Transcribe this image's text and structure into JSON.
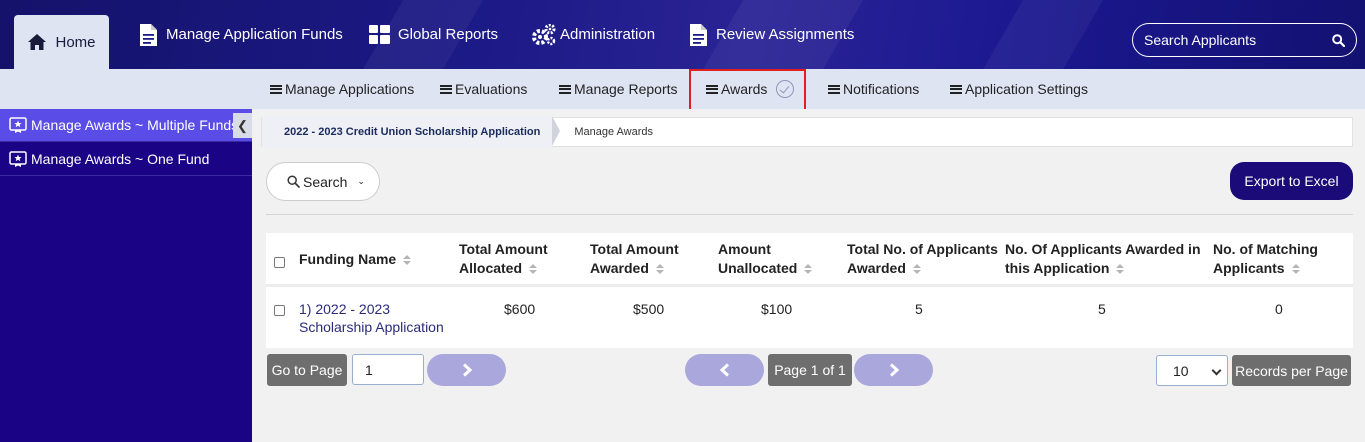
{
  "topnav": {
    "items": [
      {
        "label": "Home",
        "icon": "home-icon"
      },
      {
        "label": "Manage Application Funds",
        "icon": "document-icon"
      },
      {
        "label": "Global Reports",
        "icon": "grid-icon"
      },
      {
        "label": "Administration",
        "icon": "gears-icon"
      },
      {
        "label": "Review Assignments",
        "icon": "document-icon"
      }
    ],
    "search_placeholder": "Search Applicants"
  },
  "subnav": {
    "items": [
      {
        "label": "Manage Applications"
      },
      {
        "label": "Evaluations"
      },
      {
        "label": "Manage Reports"
      },
      {
        "label": "Awards"
      },
      {
        "label": "Notifications"
      },
      {
        "label": "Application Settings"
      }
    ],
    "active": "Awards"
  },
  "sidebar": {
    "items": [
      {
        "label": "Manage Awards ~ Multiple Funds",
        "active": true
      },
      {
        "label": "Manage Awards ~ One Fund",
        "active": false
      }
    ]
  },
  "breadcrumb": {
    "parent": "2022 - 2023 Credit Union Scholarship Application",
    "current": "Manage Awards"
  },
  "toolbar": {
    "search_label": "Search",
    "export_label": "Export to Excel"
  },
  "table": {
    "headers": {
      "funding_name": "Funding Name",
      "total_allocated_1": "Total Amount",
      "total_allocated_2": "Allocated",
      "total_awarded_1": "Total Amount",
      "total_awarded_2": "Awarded",
      "unallocated_1": "Amount",
      "unallocated_2": "Unallocated",
      "applicants_awarded_1": "Total No. of Applicants",
      "applicants_awarded_2": "Awarded",
      "awarded_in_app_1": "No. Of Applicants Awarded in",
      "awarded_in_app_2": "this Application",
      "matching_1": "No. of Matching",
      "matching_2": "Applicants"
    },
    "rows": [
      {
        "funding_name_1": "1) 2022 - 2023",
        "funding_name_2": "Scholarship Application",
        "total_allocated": "$600",
        "total_awarded": "$500",
        "unallocated": "$100",
        "applicants_awarded": "5",
        "awarded_in_app": "5",
        "matching": "0"
      }
    ]
  },
  "pager": {
    "go_label": "Go to Page",
    "page_value": "1",
    "page_info": "Page 1 of 1",
    "records_value": "10",
    "records_label": "Records per Page"
  },
  "colors": {
    "topbar": "#1c1a86",
    "subbar": "#dfe4f3",
    "sidebar": "#1a0485",
    "sidebar_active": "#5a4ce6",
    "export_button": "#1a0b79",
    "highlight_box": "#e0201f"
  }
}
